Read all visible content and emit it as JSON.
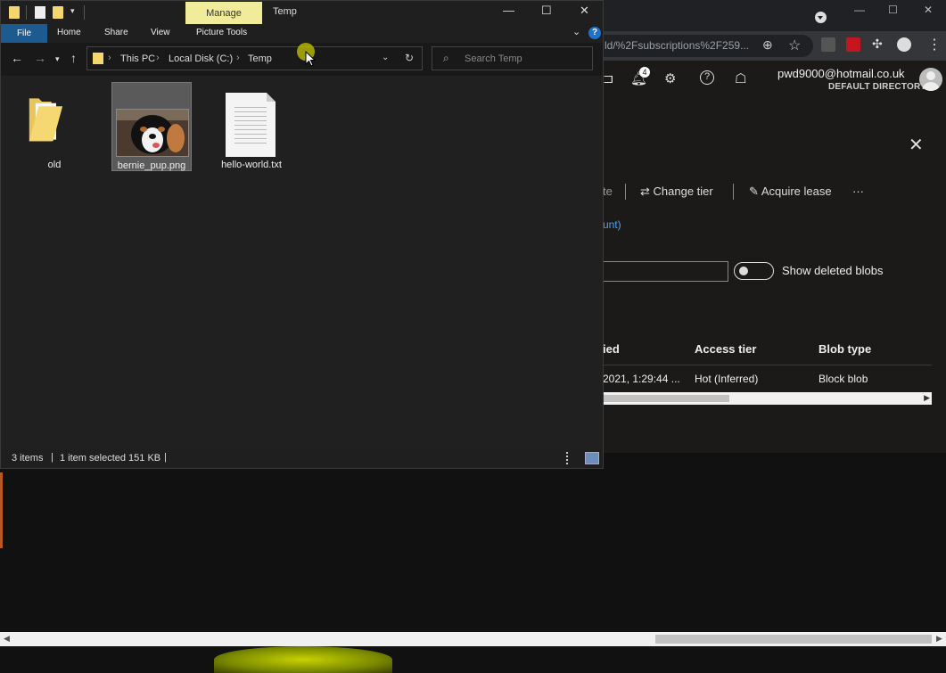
{
  "browser": {
    "url_fragment": "ld/%2Fsubscriptions%2F259...",
    "notifications_count": "4",
    "user_email": "pwd9000@hotmail.co.uk",
    "user_directory": "DEFAULT DIRECTORY",
    "commands": {
      "truncated": "te",
      "change_tier": "Change tier",
      "acquire_lease": "Acquire lease",
      "more": "···"
    },
    "link_fragment": "unt)",
    "toggle_label": "Show deleted blobs",
    "columns": {
      "modified": "ied",
      "access_tier": "Access tier",
      "blob_type": "Blob type"
    },
    "row": {
      "modified": "2021, 1:29:44 ...",
      "access_tier": "Hot (Inferred)",
      "blob_type": "Block blob"
    }
  },
  "explorer": {
    "context_tab": "Manage",
    "window_title": "Temp",
    "ribbon": {
      "file": "File",
      "home": "Home",
      "share": "Share",
      "view": "View",
      "picture_tools": "Picture Tools"
    },
    "breadcrumb": [
      "This PC",
      "Local Disk (C:)",
      "Temp"
    ],
    "search_placeholder": "Search Temp",
    "files": [
      {
        "name": "old",
        "type": "folder",
        "selected": false
      },
      {
        "name": "bernie_pup.png",
        "type": "image",
        "selected": true
      },
      {
        "name": "hello-world.txt",
        "type": "text",
        "selected": false
      }
    ],
    "status": {
      "items": "3 items",
      "selected": "1 item selected  151 KB"
    }
  },
  "colors": {
    "manage_tab": "#f1ec9a",
    "file_tab": "#1d5a8f",
    "link": "#4aa3ff"
  }
}
